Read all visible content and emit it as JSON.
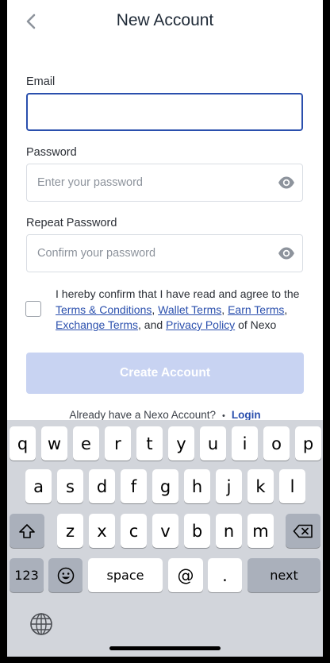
{
  "header": {
    "title": "New Account"
  },
  "form": {
    "email": {
      "label": "Email",
      "value": "",
      "placeholder": ""
    },
    "password": {
      "label": "Password",
      "value": "",
      "placeholder": "Enter your password"
    },
    "repeat_password": {
      "label": "Repeat Password",
      "value": "",
      "placeholder": "Confirm your password"
    },
    "consent": {
      "checked": false,
      "text_prefix": "I hereby confirm that I have read and agree to the ",
      "terms": "Terms & Conditions",
      "sep1": ", ",
      "wallet": "Wallet Terms",
      "sep2": ", ",
      "earn": "Earn Terms",
      "sep3": ",",
      "exchange": "Exchange Terms",
      "sep4": ", and ",
      "privacy": "Privacy Policy",
      "suffix": " of Nexo"
    },
    "submit_label": "Create Account",
    "login_prompt": "Already have a Nexo Account?",
    "login_dot": "•",
    "login_link": "Login"
  },
  "keyboard": {
    "row1": [
      "q",
      "w",
      "e",
      "r",
      "t",
      "y",
      "u",
      "i",
      "o",
      "p"
    ],
    "row2": [
      "a",
      "s",
      "d",
      "f",
      "g",
      "h",
      "j",
      "k",
      "l"
    ],
    "row3": [
      "z",
      "x",
      "c",
      "v",
      "b",
      "n",
      "m"
    ],
    "numbers_key": "123",
    "space_key": "space",
    "at_key": "@",
    "dot_key": ".",
    "next_key": "next"
  },
  "colors": {
    "accent": "#2a4fad",
    "button_disabled": "#c8d3f2",
    "keyboard_bg": "#d2d5db"
  }
}
